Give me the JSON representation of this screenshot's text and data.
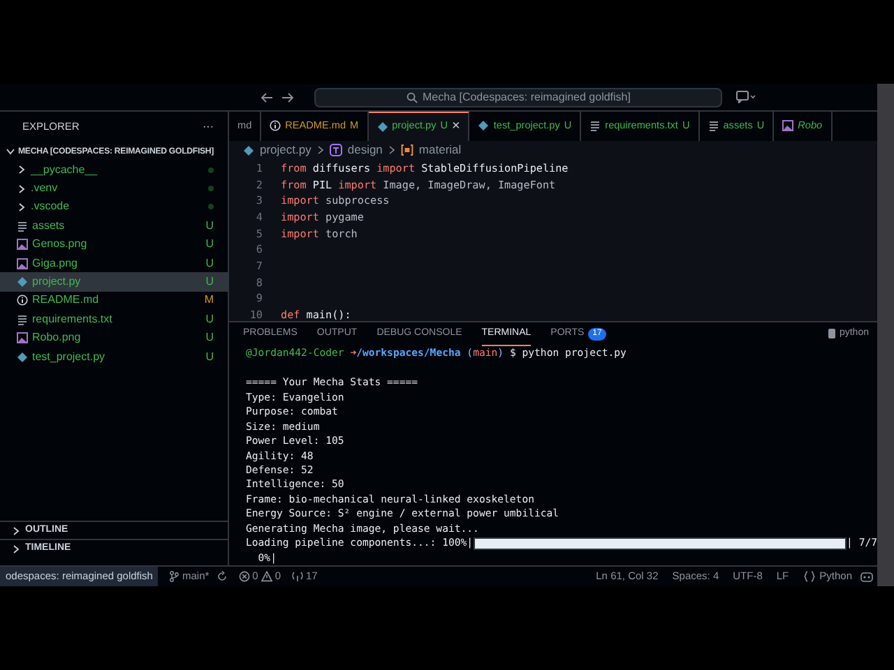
{
  "title_bar": {
    "search": "Mecha [Codespaces: reimagined goldfish]"
  },
  "explorer": {
    "title": "EXPLORER",
    "more": "···",
    "root": {
      "label": "MECHA [CODESPACES: REIMAGINED GOLDFISH]",
      "expanded": true,
      "children": [
        {
          "label": "__pycache__",
          "kind": "folder",
          "expanded": false,
          "selected": false
        },
        {
          "label": ".venv",
          "kind": "folder",
          "expanded": false,
          "selected": false
        },
        {
          "label": ".vscode",
          "kind": "folder",
          "expanded": false,
          "selected": false
        },
        {
          "label": "assets",
          "kind": "text",
          "status": "U",
          "selected": false
        },
        {
          "label": "Genos.png",
          "kind": "image",
          "status": "U",
          "selected": false
        },
        {
          "label": "Giga.png",
          "kind": "image",
          "status": "U",
          "selected": false
        },
        {
          "label": "project.py",
          "kind": "python",
          "status": "U",
          "selected": true
        },
        {
          "label": "README.md",
          "kind": "info",
          "status": "M",
          "selected": false
        },
        {
          "label": "requirements.txt",
          "kind": "text",
          "status": "U",
          "selected": false
        },
        {
          "label": "Robo.png",
          "kind": "image",
          "status": "U",
          "selected": false
        },
        {
          "label": "test_project.py",
          "kind": "python",
          "status": "U",
          "selected": false
        }
      ]
    },
    "sections": [
      {
        "label": "OUTLINE",
        "expanded": false
      },
      {
        "label": "TIMELINE",
        "expanded": false
      }
    ]
  },
  "tabs": [
    {
      "label": "md",
      "kind": "none",
      "selected": false
    },
    {
      "label": "README.md",
      "kind": "info",
      "status": "M",
      "selected": false
    },
    {
      "label": "project.py",
      "kind": "python",
      "status": "U",
      "selected": true,
      "close": "×"
    },
    {
      "label": "test_project.py",
      "kind": "python",
      "status": "U",
      "selected": false
    },
    {
      "label": "requirements.txt",
      "kind": "text",
      "status": "U",
      "selected": false
    },
    {
      "label": "assets",
      "kind": "text",
      "status": "U",
      "selected": false
    },
    {
      "label": "Robo",
      "kind": "image",
      "selected": false
    }
  ],
  "breadcrumb": [
    {
      "label": "project.py",
      "kind": "python"
    },
    {
      "label": "design",
      "kind": "class"
    },
    {
      "label": "material",
      "kind": "variable"
    }
  ],
  "code": [
    {
      "n": "1",
      "tokens": [
        {
          "t": "from",
          "kind": "kw"
        },
        {
          "t": " diffusers ",
          "kind": "id"
        },
        {
          "t": "import",
          "kind": "kw"
        },
        {
          "t": " StableDiffusionPipeline",
          "kind": "id"
        }
      ]
    },
    {
      "n": "2",
      "tokens": [
        {
          "t": "from",
          "kind": "kw"
        },
        {
          "t": " PIL ",
          "kind": "id"
        },
        {
          "t": "import",
          "kind": "kw"
        },
        {
          "t": " Image, ImageDraw, ImageFont",
          "kind": "dim"
        }
      ]
    },
    {
      "n": "3",
      "tokens": [
        {
          "t": "import",
          "kind": "kw"
        },
        {
          "t": " subprocess",
          "kind": "dim"
        }
      ]
    },
    {
      "n": "4",
      "tokens": [
        {
          "t": "import",
          "kind": "kw"
        },
        {
          "t": " pygame",
          "kind": "dim"
        }
      ]
    },
    {
      "n": "5",
      "tokens": [
        {
          "t": "import",
          "kind": "kw"
        },
        {
          "t": " torch",
          "kind": "dim"
        }
      ]
    },
    {
      "n": "6"
    },
    {
      "n": "7"
    },
    {
      "n": "8"
    },
    {
      "n": "9"
    },
    {
      "n": "10",
      "tokens": [
        {
          "t": "def",
          "kind": "kw"
        },
        {
          "t": " main():",
          "kind": "id"
        }
      ]
    }
  ],
  "panel": {
    "tabs": [
      {
        "label": "PROBLEMS",
        "selected": false
      },
      {
        "label": "OUTPUT",
        "selected": false
      },
      {
        "label": "DEBUG CONSOLE",
        "selected": false
      },
      {
        "label": "TERMINAL",
        "selected": true
      },
      {
        "label": "PORTS",
        "selected": false,
        "badge": "17"
      }
    ],
    "shell": "python",
    "terminal": [
      {
        "kind": "prompt",
        "user": "@Jordan442-Coder",
        "arrow": "➜",
        "path": "/workspaces/Mecha",
        "branch_open": "(",
        "branch": "main",
        "branch_close": ")",
        "command": "$ python project.py"
      },
      {
        "kind": "blank"
      },
      {
        "kind": "text",
        "text": "===== Your Mecha Stats ====="
      },
      {
        "kind": "text",
        "text": "Type: Evangelion"
      },
      {
        "kind": "text",
        "text": "Purpose: combat"
      },
      {
        "kind": "text",
        "text": "Size: medium"
      },
      {
        "kind": "text",
        "text": "Power Level: 105"
      },
      {
        "kind": "text",
        "text": "Agility: 48"
      },
      {
        "kind": "text",
        "text": "Defense: 52"
      },
      {
        "kind": "text",
        "text": "Intelligence: 50"
      },
      {
        "kind": "text",
        "text": "Frame: bio-mechanical neural-linked exoskeleton"
      },
      {
        "kind": "text",
        "text": "Energy Source: S² engine / external power umbilical"
      },
      {
        "kind": "text",
        "text": "Generating Mecha image, please wait..."
      },
      {
        "kind": "progress",
        "text": "Loading pipeline components...: 100%|",
        "level": 1,
        "end": "| 7/7"
      },
      {
        "kind": "text",
        "text": "  0%|"
      }
    ]
  },
  "status_bar": {
    "remote": "odespaces: reimagined goldfish",
    "branch": "main*",
    "errors": "0",
    "warnings": "0",
    "ports": "17",
    "position": "Ln 61, Col 32",
    "spaces": "Spaces: 4",
    "encoding": "UTF-8",
    "eol": "LF",
    "language": "Python"
  }
}
